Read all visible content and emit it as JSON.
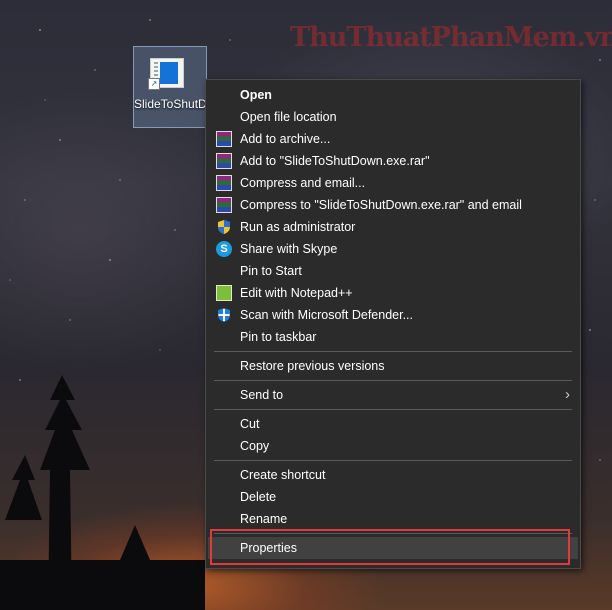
{
  "watermark": "ThuThuatPhanMem.vn",
  "desktop_icon": {
    "label": "SlideToShutDown.exe"
  },
  "menu": {
    "open": "Open",
    "open_file_location": "Open file location",
    "add_to_archive": "Add to archive...",
    "add_to_rar": "Add to \"SlideToShutDown.exe.rar\"",
    "compress_email": "Compress and email...",
    "compress_rar_email": "Compress to \"SlideToShutDown.exe.rar\" and email",
    "run_as_admin": "Run as administrator",
    "share_skype": "Share with Skype",
    "pin_start": "Pin to Start",
    "edit_npp": "Edit with Notepad++",
    "scan_defender": "Scan with Microsoft Defender...",
    "pin_taskbar": "Pin to taskbar",
    "restore_versions": "Restore previous versions",
    "send_to": "Send to",
    "cut": "Cut",
    "copy": "Copy",
    "create_shortcut": "Create shortcut",
    "delete": "Delete",
    "rename": "Rename",
    "properties": "Properties"
  },
  "colors": {
    "highlight_box": "#e03a3a",
    "menu_bg": "#2b2b2b"
  }
}
